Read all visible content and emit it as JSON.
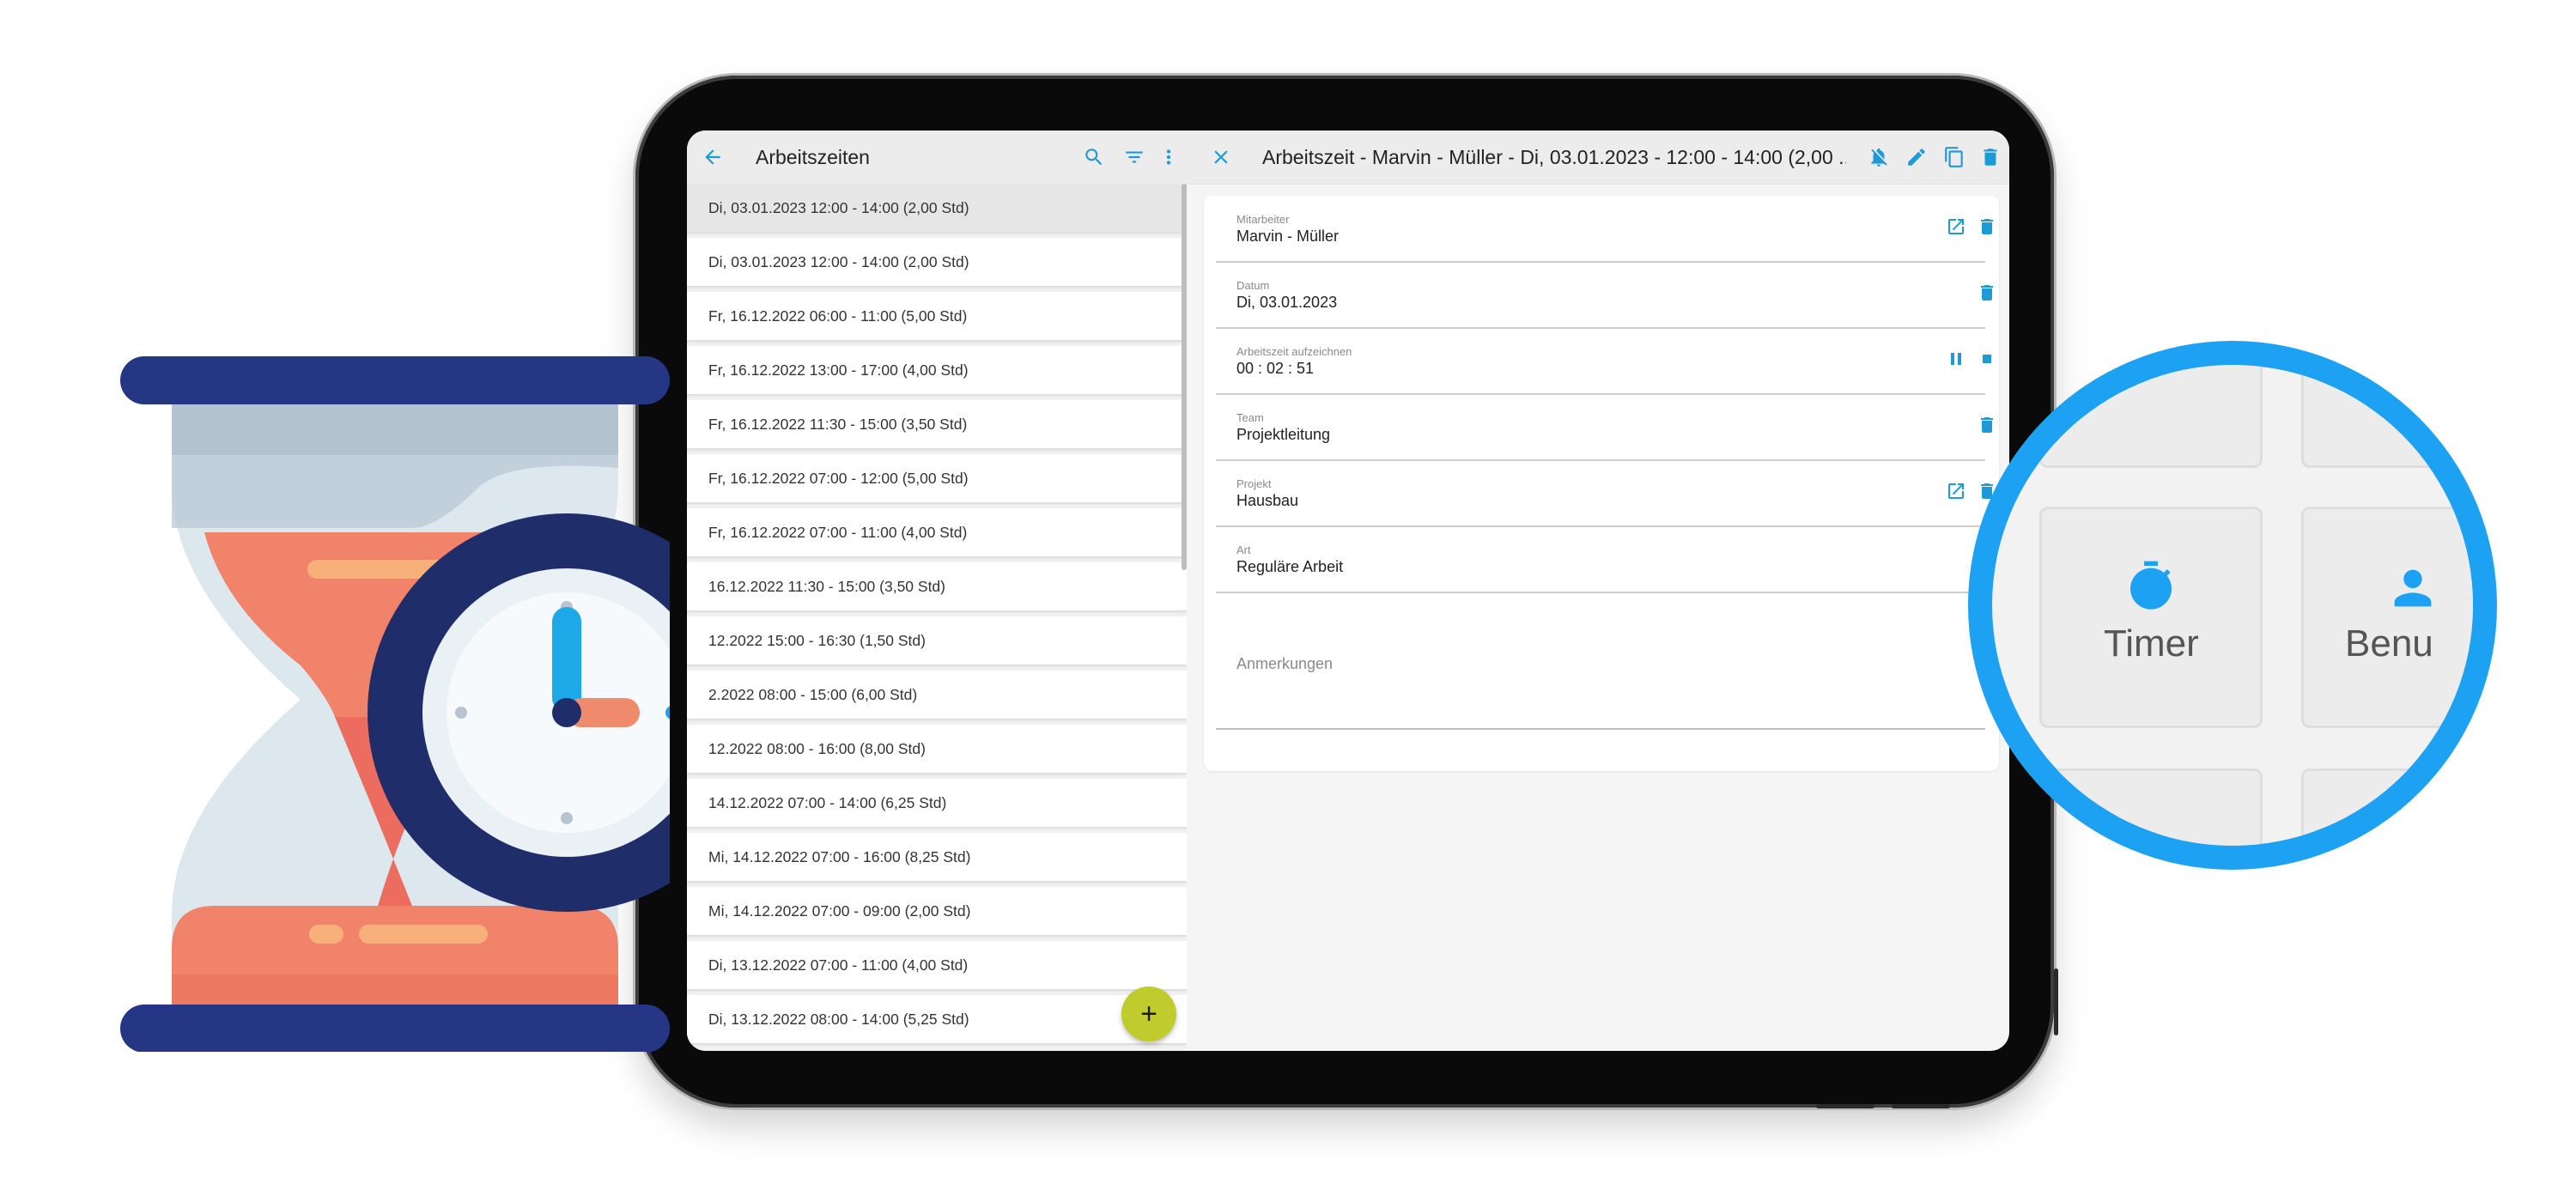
{
  "app_bar": {
    "list_title": "Arbeitszeiten",
    "detail_title": "Arbeitszeit - Marvin - Müller - Di, 03.01.2023 - 12:00 - 14:00 (2,00 ..."
  },
  "list": {
    "items": [
      {
        "label": "Di, 03.01.2023 12:00 - 14:00 (2,00 Std)",
        "selected": true
      },
      {
        "label": "Di, 03.01.2023 12:00 - 14:00 (2,00 Std)"
      },
      {
        "label": "Fr, 16.12.2022 06:00 - 11:00 (5,00 Std)"
      },
      {
        "label": "Fr, 16.12.2022 13:00 - 17:00 (4,00 Std)"
      },
      {
        "label": "Fr, 16.12.2022 11:30 - 15:00 (3,50 Std)"
      },
      {
        "label": "Fr, 16.12.2022 07:00 - 12:00 (5,00 Std)"
      },
      {
        "label": "Fr, 16.12.2022 07:00 - 11:00 (4,00 Std)"
      },
      {
        "label": "16.12.2022 11:30 - 15:00 (3,50 Std)"
      },
      {
        "label": "12.2022 15:00 - 16:30 (1,50 Std)"
      },
      {
        "label": "2.2022 08:00 - 15:00 (6,00 Std)"
      },
      {
        "label": "12.2022 08:00 - 16:00 (8,00 Std)"
      },
      {
        "label": "14.12.2022 07:00 - 14:00 (6,25 Std)"
      },
      {
        "label": "Mi, 14.12.2022 07:00 - 16:00 (8,25 Std)"
      },
      {
        "label": "Mi, 14.12.2022 07:00 - 09:00 (2,00 Std)"
      },
      {
        "label": "Di, 13.12.2022 07:00 - 11:00 (4,00 Std)"
      },
      {
        "label": "Di, 13.12.2022 08:00 - 14:00 (5,25 Std)"
      }
    ],
    "fab_label": "+"
  },
  "detail": {
    "fields": [
      {
        "label": "Mitarbeiter",
        "value": "Marvin - Müller"
      },
      {
        "label": "Datum",
        "value": "Di, 03.01.2023"
      },
      {
        "label": "Arbeitszeit aufzeichnen",
        "value": "00 : 02 : 51"
      },
      {
        "label": "Team",
        "value": "Projektleitung"
      },
      {
        "label": "Projekt",
        "value": "Hausbau"
      },
      {
        "label": "Art",
        "value": "Reguläre Arbeit"
      }
    ],
    "remarks_label": "Anmerkungen"
  },
  "zoom": {
    "tile_timer_label": "Timer",
    "tile_user_label": "Benu"
  },
  "colors": {
    "accent": "#1e9ad6",
    "fab": "#c0cc2e",
    "zoom_ring": "#1da1f2",
    "hourglass_frame": "#263a8c",
    "hourglass_sand": "#f0836a",
    "clock_ring": "#1f2e6b"
  },
  "icons": [
    "back-arrow-icon",
    "search-icon",
    "filter-icon",
    "more-vert-icon",
    "close-icon",
    "notifications-off-icon",
    "edit-icon",
    "copy-icon",
    "delete-icon",
    "open-in-new-icon",
    "pause-icon",
    "stop-icon",
    "timer-icon",
    "person-icon"
  ]
}
